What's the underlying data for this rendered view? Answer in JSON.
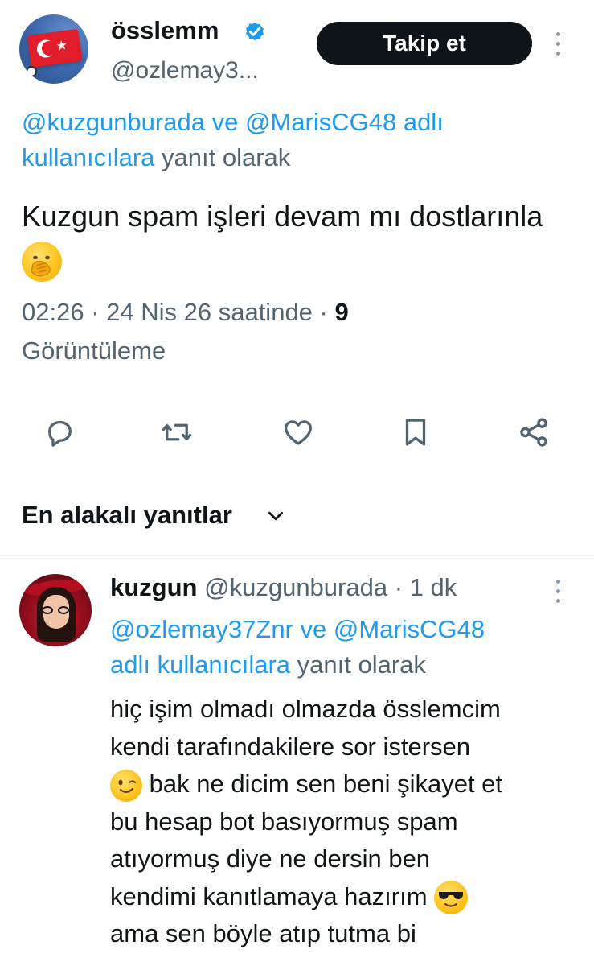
{
  "tweet": {
    "display_name": "össlemm",
    "handle": "@ozlemay3...",
    "follow_label": "Takip et",
    "reply_context": {
      "mention1": "@kuzgunburada",
      "connector": "ve",
      "mention2": "@MarisCG48",
      "suffix_link": "adlı kullanıcılara",
      "suffix": "yanıt olarak"
    },
    "text": "Kuzgun spam işleri devam mı dostlarınla",
    "emoji": "face-with-hand-over-mouth",
    "time": "02:26",
    "date": "24 Nis 26 saatinde",
    "views_count": "9",
    "views_label": "Görüntüleme",
    "actions": [
      "reply-icon",
      "retweet-icon",
      "like-icon",
      "bookmark-icon",
      "share-icon"
    ]
  },
  "replies_header": {
    "label": "En alakalı yanıtlar"
  },
  "reply": {
    "display_name": "kuzgun",
    "handle": "@kuzgunburada",
    "separator": "·",
    "time": "1 dk",
    "reply_context": {
      "mention1": "@ozlemay37Znr",
      "connector": "ve",
      "mention2": "@MarisCG48",
      "suffix_link": "adlı kullanıcılara",
      "suffix": "yanıt olarak"
    },
    "lines": {
      "l1": "hiç işim olmadı olmazda össlemcim",
      "l2": "kendi tarafındakilere sor istersen",
      "l3": "bak ne dicim sen beni şikayet et",
      "l4": "bu hesap bot basıyormuş spam",
      "l5": "atıyormuş diye ne dersin ben",
      "l6": "kendimi kanıtlamaya hazırım",
      "l7": "ama sen böyle atıp tutma bi"
    },
    "emojis": [
      "winking-face",
      "smiling-face-with-sunglasses"
    ]
  },
  "colors": {
    "link": "#1d9bf0",
    "secondary_text": "#536471",
    "primary_text": "#0f1419",
    "follow_button_bg": "#0f1419"
  }
}
